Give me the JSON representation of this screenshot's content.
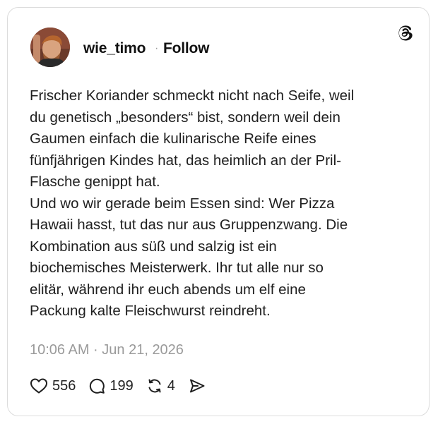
{
  "post": {
    "username": "wie_timo",
    "separator": "·",
    "follow_label": "Follow",
    "text_lines": [
      "Frischer Koriander schmeckt nicht nach Seife, weil",
      "du genetisch „besonders“ bist, sondern weil dein",
      "Gaumen einfach die kulinarische Reife eines",
      "fünfjährigen Kindes hat, das heimlich an der Pril-",
      "Flasche genippt hat.",
      "Und wo wir gerade beim Essen sind: Wer Pizza",
      "Hawaii hasst, tut das nur aus Gruppenzwang. Die",
      "Kombination aus süß und salzig ist ein",
      "biochemisches Meisterwerk. Ihr tut alle nur so",
      "elitär, während ihr euch abends um elf eine",
      "Packung kalte Fleischwurst reindreht."
    ],
    "timestamp": "10:06 AM · Jun 21, 2026"
  },
  "actions": {
    "likes": "556",
    "replies": "199",
    "reposts": "4"
  },
  "icons": {
    "brand": "threads-logo-icon",
    "like": "heart-icon",
    "reply": "speech-bubble-icon",
    "repost": "repost-icon",
    "share": "send-icon"
  },
  "colors": {
    "text": "#1f1f1f",
    "muted": "#9a9a9a",
    "border": "#dcdcdc",
    "background": "#ffffff"
  }
}
